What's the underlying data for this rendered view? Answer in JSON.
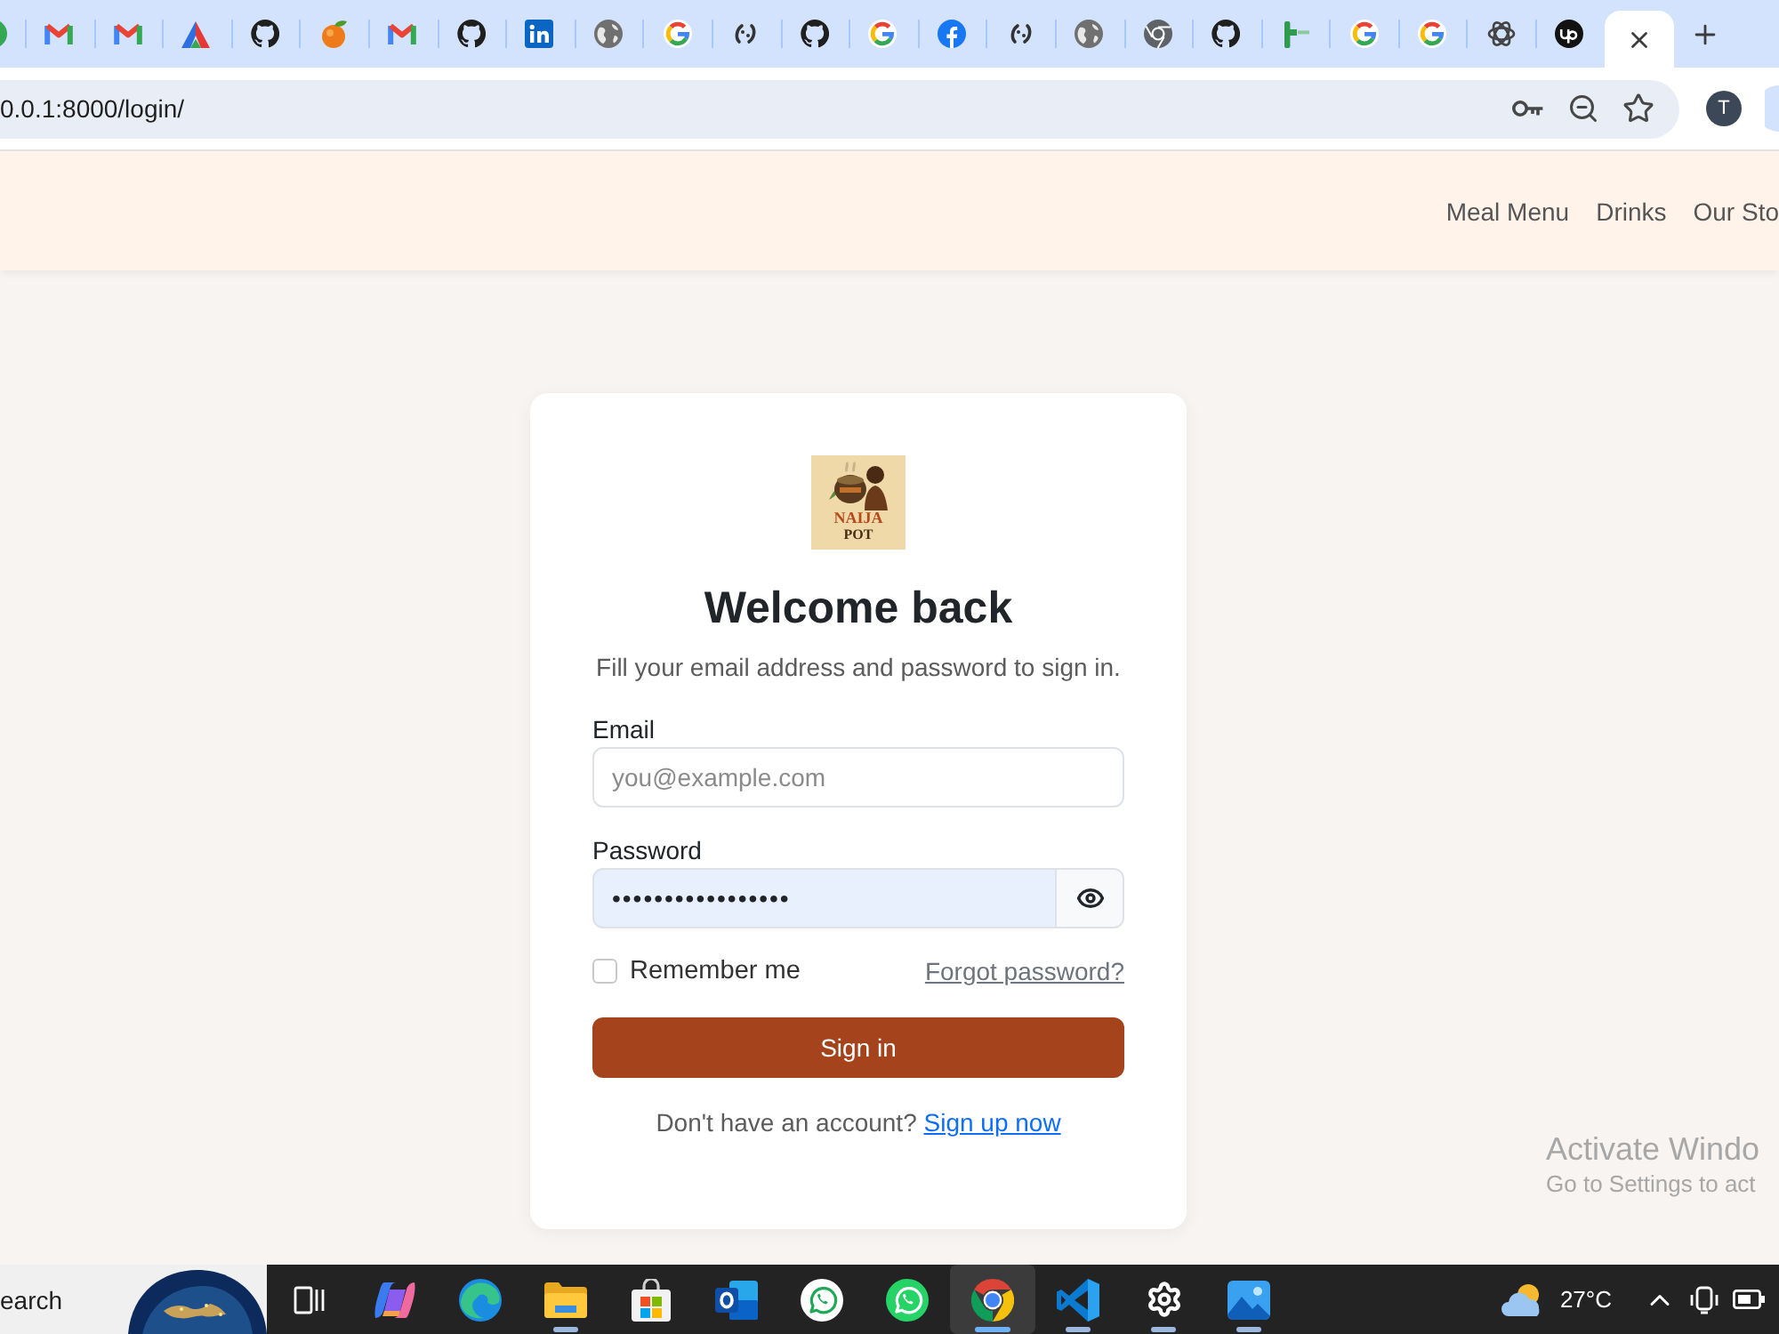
{
  "browser": {
    "tabs": [
      {
        "kind": "green-circle",
        "selected": false
      },
      {
        "kind": "gmail",
        "selected": false
      },
      {
        "kind": "gmail",
        "selected": false
      },
      {
        "kind": "triangle",
        "selected": false
      },
      {
        "kind": "github",
        "selected": false
      },
      {
        "kind": "fruit",
        "selected": false
      },
      {
        "kind": "gmail",
        "selected": false
      },
      {
        "kind": "github",
        "selected": false
      },
      {
        "kind": "linkedin",
        "selected": false
      },
      {
        "kind": "globe",
        "selected": false
      },
      {
        "kind": "google",
        "selected": false
      },
      {
        "kind": "spinner",
        "selected": false
      },
      {
        "kind": "github",
        "selected": false
      },
      {
        "kind": "google",
        "selected": false
      },
      {
        "kind": "facebook",
        "selected": false
      },
      {
        "kind": "spinner",
        "selected": false
      },
      {
        "kind": "globe",
        "selected": false
      },
      {
        "kind": "chrome",
        "selected": false
      },
      {
        "kind": "github",
        "selected": false
      },
      {
        "kind": "green-figure",
        "selected": false
      },
      {
        "kind": "google",
        "selected": false
      },
      {
        "kind": "google",
        "selected": false
      },
      {
        "kind": "openai",
        "selected": false
      },
      {
        "kind": "upwork",
        "selected": false
      },
      {
        "selected": true
      }
    ]
  },
  "toolbar": {
    "url": "0.0.1:8000/login/",
    "profile_initial": "T"
  },
  "site_header": {
    "nav": [
      {
        "label": "Meal Menu"
      },
      {
        "label": "Drinks"
      },
      {
        "label": "Our Sto"
      }
    ]
  },
  "login": {
    "logo_text": [
      "NAIJA",
      "POT"
    ],
    "title": "Welcome back",
    "subtitle": "Fill your email address and password to sign in.",
    "fields": [
      {
        "kind": "email",
        "label": "Email",
        "placeholder": "you@example.com"
      },
      {
        "kind": "password",
        "label": "Password",
        "value": "•••••••••••••••••",
        "autofilled": true,
        "shown": false
      }
    ],
    "remember": {
      "label": "Remember me",
      "checked": false
    },
    "forgot_link": "Forgot password?",
    "submit": "Sign in",
    "signup_prompt": "Don't have an account?",
    "signup_link": "Sign up now"
  },
  "activation_notice": {
    "title": "Activate Windo",
    "subtitle": "Go to Settings to act"
  },
  "taskbar": {
    "search": "earch",
    "apps": [
      {
        "kind": "task-view",
        "running": false,
        "selected": false
      },
      {
        "kind": "copilot",
        "running": false,
        "selected": false
      },
      {
        "kind": "edge",
        "running": false,
        "selected": false
      },
      {
        "kind": "file-explorer",
        "running": true,
        "selected": false
      },
      {
        "kind": "store",
        "running": false,
        "selected": false
      },
      {
        "kind": "outlook",
        "running": false,
        "selected": false
      },
      {
        "kind": "whatsapp-light",
        "running": false,
        "selected": false
      },
      {
        "kind": "whatsapp",
        "running": false,
        "selected": false
      },
      {
        "kind": "chrome",
        "running": true,
        "selected": true
      },
      {
        "kind": "vscode",
        "running": true,
        "selected": false
      },
      {
        "kind": "settings",
        "running": true,
        "selected": false
      },
      {
        "kind": "photos",
        "running": true,
        "selected": false
      }
    ],
    "weather": "27°C"
  }
}
